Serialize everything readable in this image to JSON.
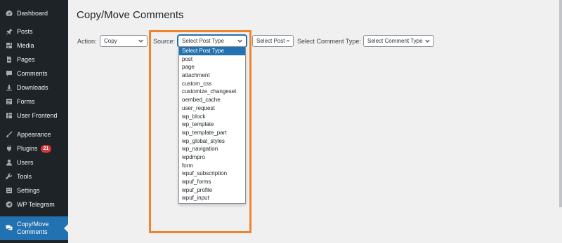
{
  "sidebar": {
    "items": [
      {
        "label": "Dashboard",
        "icon": "dashboard-icon"
      },
      {
        "label": "Posts",
        "icon": "pin-icon"
      },
      {
        "label": "Media",
        "icon": "media-icon"
      },
      {
        "label": "Pages",
        "icon": "page-icon"
      },
      {
        "label": "Comments",
        "icon": "comment-icon"
      },
      {
        "label": "Downloads",
        "icon": "download-icon"
      },
      {
        "label": "Forms",
        "icon": "forms-icon"
      },
      {
        "label": "User Frontend",
        "icon": "frontend-icon"
      },
      {
        "label": "Appearance",
        "icon": "brush-icon"
      },
      {
        "label": "Plugins",
        "icon": "plugin-icon",
        "badge": "21"
      },
      {
        "label": "Users",
        "icon": "user-icon"
      },
      {
        "label": "Tools",
        "icon": "wrench-icon"
      },
      {
        "label": "Settings",
        "icon": "settings-icon"
      },
      {
        "label": "WP Telegram",
        "icon": "telegram-icon"
      },
      {
        "label": "Copy/Move Comments",
        "icon": "copy-comments-icon"
      }
    ]
  },
  "page": {
    "title": "Copy/Move Comments"
  },
  "form": {
    "action_label": "Action:",
    "action_value": "Copy",
    "source_label": "Source:",
    "source_value": "Select Post Type",
    "select_post_value": "Select Post",
    "comment_type_label": "Select Comment Type:",
    "comment_type_value": "Select Comment Type"
  },
  "dropdown": {
    "options": [
      "Select Post Type",
      "post",
      "page",
      "attachment",
      "custom_css",
      "customize_changeset",
      "oembed_cache",
      "user_request",
      "wp_block",
      "wp_template",
      "wp_template_part",
      "wp_global_styles",
      "wp_navigation",
      "wpdmpro",
      "form",
      "wpuf_subscription",
      "wpuf_forms",
      "wpuf_profile",
      "wpuf_input"
    ],
    "selected": "Select Post Type"
  },
  "colors": {
    "sidebar_bg": "#1d2327",
    "active_bg": "#2271b1",
    "highlight": "#f0842c",
    "badge": "#d63638"
  }
}
